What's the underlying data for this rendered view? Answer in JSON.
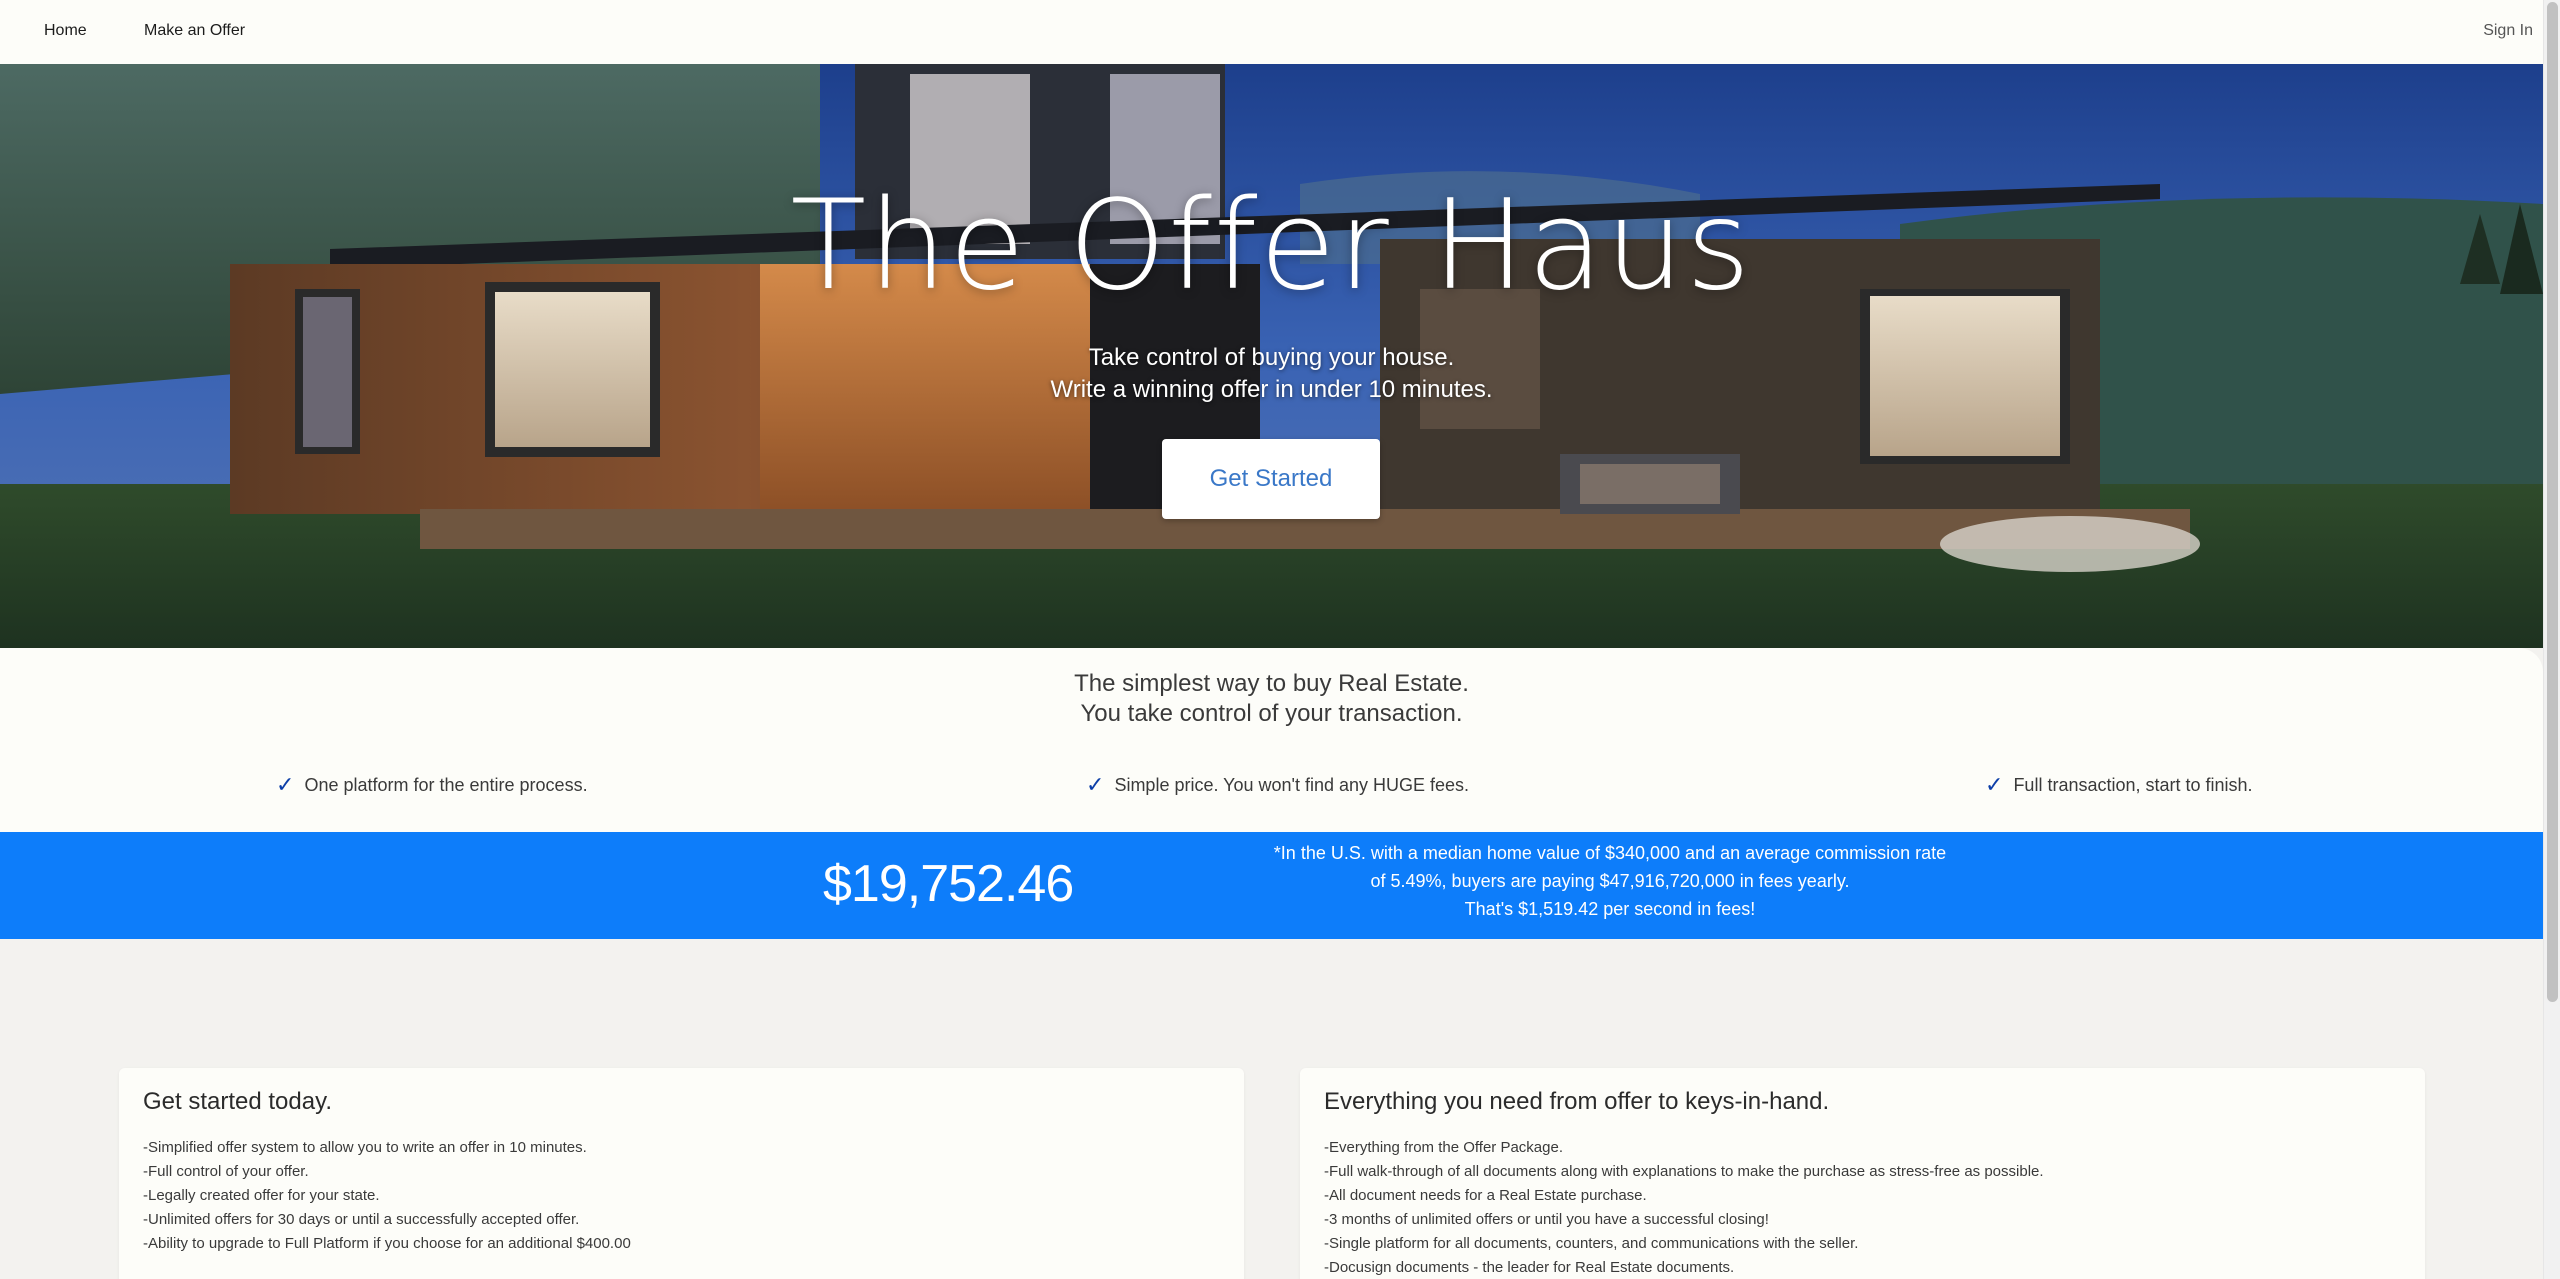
{
  "nav": {
    "home": "Home",
    "make_offer": "Make an Offer",
    "sign_in": "Sign In"
  },
  "hero": {
    "title": "The Offer Haus",
    "subtitle_line1": "Take control of buying your house.",
    "subtitle_line2": "Write a winning offer in under 10 minutes.",
    "cta": "Get Started"
  },
  "intro": {
    "line1": "The simplest way to buy Real Estate.",
    "line2": "You take control of your transaction.",
    "features": [
      {
        "icon": "check-icon",
        "text": "One platform for the entire process."
      },
      {
        "icon": "check-icon",
        "text": "Simple price. You won't find any HUGE fees."
      },
      {
        "icon": "check-icon",
        "text": "Full transaction, start to finish."
      }
    ]
  },
  "stat_band": {
    "amount": "$19,752.46",
    "note_line1": "*In the U.S. with a median home value of $340,000 and an average commission rate",
    "note_line2": "of 5.49%, buyers are paying $47,916,720,000 in fees yearly.",
    "note_line3": "That's $1,519.42 per second in fees!",
    "color": "#0d7dfa"
  },
  "cards": [
    {
      "title": "Get started today.",
      "items": [
        "-Simplified offer system to allow you to write an offer in 10 minutes.",
        "-Full control of your offer.",
        "-Legally created offer for your state.",
        "-Unlimited offers for 30 days or until a successfully accepted offer.",
        "-Ability to upgrade to Full Platform if you choose for an additional $400.00"
      ]
    },
    {
      "title": "Everything you need from offer to keys-in-hand.",
      "items": [
        "-Everything from the Offer Package.",
        "-Full walk-through of all documents along with explanations to make the purchase as stress-free as possible.",
        "-All document needs for a Real Estate purchase.",
        "-3 months of unlimited offers or until you have a successful closing!",
        "-Single platform for all documents, counters, and communications with the seller.",
        "-Docusign documents - the leader for Real Estate documents."
      ]
    }
  ]
}
